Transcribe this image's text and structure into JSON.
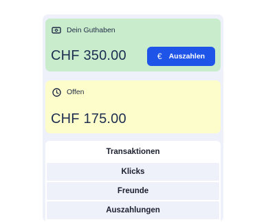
{
  "balance_card": {
    "label": "Dein Guthaben",
    "icon": "wallet-icon",
    "amount": "CHF 350.00",
    "payout_button": {
      "icon": "euro-icon",
      "label": "Auszahlen"
    }
  },
  "open_card": {
    "label": "Offen",
    "icon": "clock-icon",
    "amount": "CHF 175.00"
  },
  "tabs": [
    {
      "label": "Transaktionen",
      "active": true
    },
    {
      "label": "Klicks",
      "active": false
    },
    {
      "label": "Freunde",
      "active": false
    },
    {
      "label": "Auszahlungen",
      "active": false
    }
  ],
  "colors": {
    "balance_bg": "#c9eccd",
    "open_bg": "#fdfccb",
    "accent": "#1f54e8",
    "panel_bg": "#eef0fa"
  }
}
